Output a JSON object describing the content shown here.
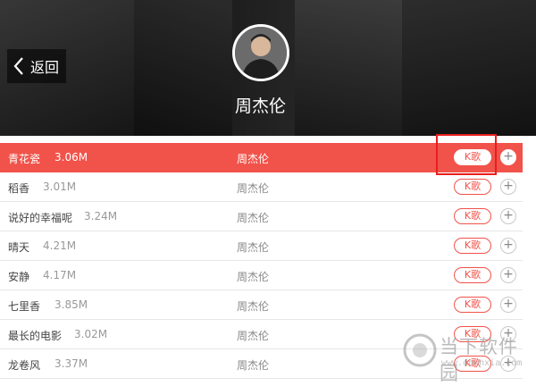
{
  "header": {
    "back_label": "返回",
    "artist_name": "周杰伦"
  },
  "songs": [
    {
      "title": "青花瓷",
      "size": "3.06M",
      "artist": "周杰伦",
      "kge_label": "K歌",
      "active": true
    },
    {
      "title": "稻香",
      "size": "3.01M",
      "artist": "周杰伦",
      "kge_label": "K歌",
      "active": false
    },
    {
      "title": "说好的幸福呢",
      "size": "3.24M",
      "artist": "周杰伦",
      "kge_label": "K歌",
      "active": false
    },
    {
      "title": "晴天",
      "size": "4.21M",
      "artist": "周杰伦",
      "kge_label": "K歌",
      "active": false
    },
    {
      "title": "安静",
      "size": "4.17M",
      "artist": "周杰伦",
      "kge_label": "K歌",
      "active": false
    },
    {
      "title": "七里香",
      "size": "3.85M",
      "artist": "周杰伦",
      "kge_label": "K歌",
      "active": false
    },
    {
      "title": "最长的电影",
      "size": "3.02M",
      "artist": "周杰伦",
      "kge_label": "K歌",
      "active": false
    },
    {
      "title": "龙卷风",
      "size": "3.37M",
      "artist": "周杰伦",
      "kge_label": "K歌",
      "active": false
    }
  ],
  "icons": {
    "back": "chevron-left-icon",
    "add": "plus-icon"
  },
  "colors": {
    "accent": "#f1524a",
    "highlight_box": "#e81e1e"
  },
  "watermark": {
    "title": "当下软件园",
    "url": "www.downxia.com"
  }
}
